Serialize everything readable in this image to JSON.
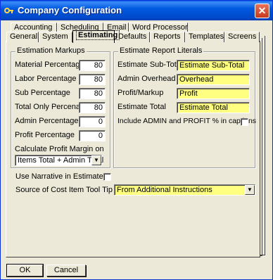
{
  "window": {
    "title": "Company Configuration",
    "close_glyph": "✕",
    "app_icon": "key-icon"
  },
  "tabs": {
    "back": [
      "Accounting",
      "Scheduling",
      "Email",
      "Word Processor"
    ],
    "front": [
      "General",
      "System",
      "Estimating",
      "Defaults",
      "Reports",
      "Templates",
      "Screens"
    ],
    "active": "Estimating"
  },
  "markups": {
    "legend": "Estimation Markups",
    "rows": [
      {
        "label": "Material Percentage",
        "value": "80"
      },
      {
        "label": "Labor Percentage",
        "value": "80"
      },
      {
        "label": "Sub Percentage",
        "value": "80"
      },
      {
        "label": "Total Only Percenage",
        "value": "80"
      },
      {
        "label": "Admin Percentage",
        "value": "0"
      },
      {
        "label": "Profit Percentage",
        "value": "0"
      }
    ],
    "margin_label": "Calculate Profit Margin on",
    "margin_value": "Items Total + Admin Total"
  },
  "literals": {
    "legend": "Estimate Report Literals",
    "rows": [
      {
        "label": "Estimate Sub-Total",
        "value": "Estimate Sub-Total"
      },
      {
        "label": "Admin Overhead",
        "value": "Overhead"
      },
      {
        "label": "Profit/Markup",
        "value": "Profit"
      },
      {
        "label": "Estimate Total",
        "value": "Estimate Total"
      }
    ],
    "include_label": "Include ADMIN and PROFIT % in captions",
    "include_checked": false
  },
  "narrative": {
    "label": "Use Narrative in Estimates",
    "checked": false
  },
  "tooltip_source": {
    "label": "Source of Cost Item Tool Tip Text",
    "value": "From Additional Instructions"
  },
  "buttons": {
    "ok": "OK",
    "cancel": "Cancel"
  },
  "colors": {
    "titlebar": "#0058e6",
    "literal_field": "#ffff80",
    "dialog_bg": "#ece9d8"
  }
}
